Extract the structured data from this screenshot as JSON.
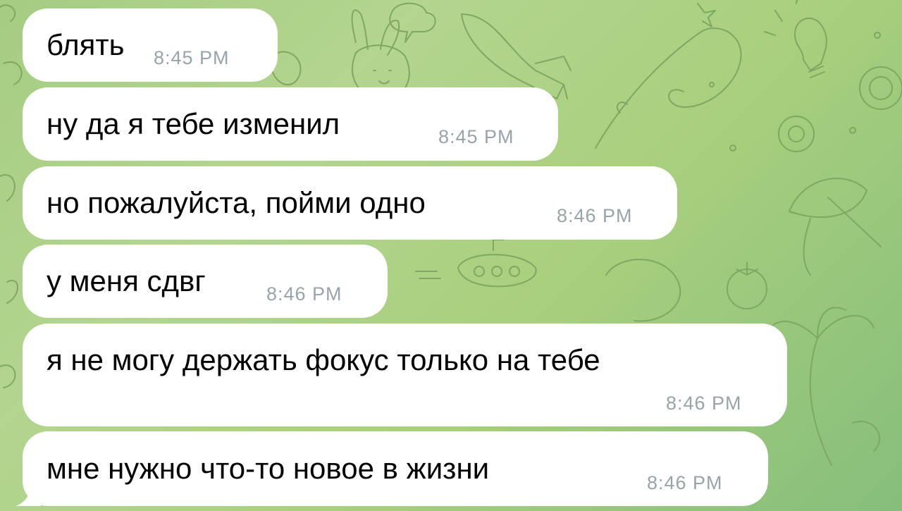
{
  "messages": [
    {
      "text": "блять",
      "time": "8:45 PM"
    },
    {
      "text": "ну да я тебе изменил",
      "time": "8:45 PM"
    },
    {
      "text": "но пожалуйста, пойми одно",
      "time": "8:46 PM"
    },
    {
      "text": "у меня сдвг",
      "time": "8:46 PM"
    },
    {
      "text": "я не могу держать фокус только на тебе",
      "time": "8:46 PM"
    },
    {
      "text": "мне нужно что-то новое в жизни",
      "time": "8:46 PM"
    }
  ],
  "theme": {
    "bubble_color": "#ffffff",
    "text_color": "#000000",
    "time_color": "#9aa3a8",
    "background_color": "#a5cc82"
  }
}
